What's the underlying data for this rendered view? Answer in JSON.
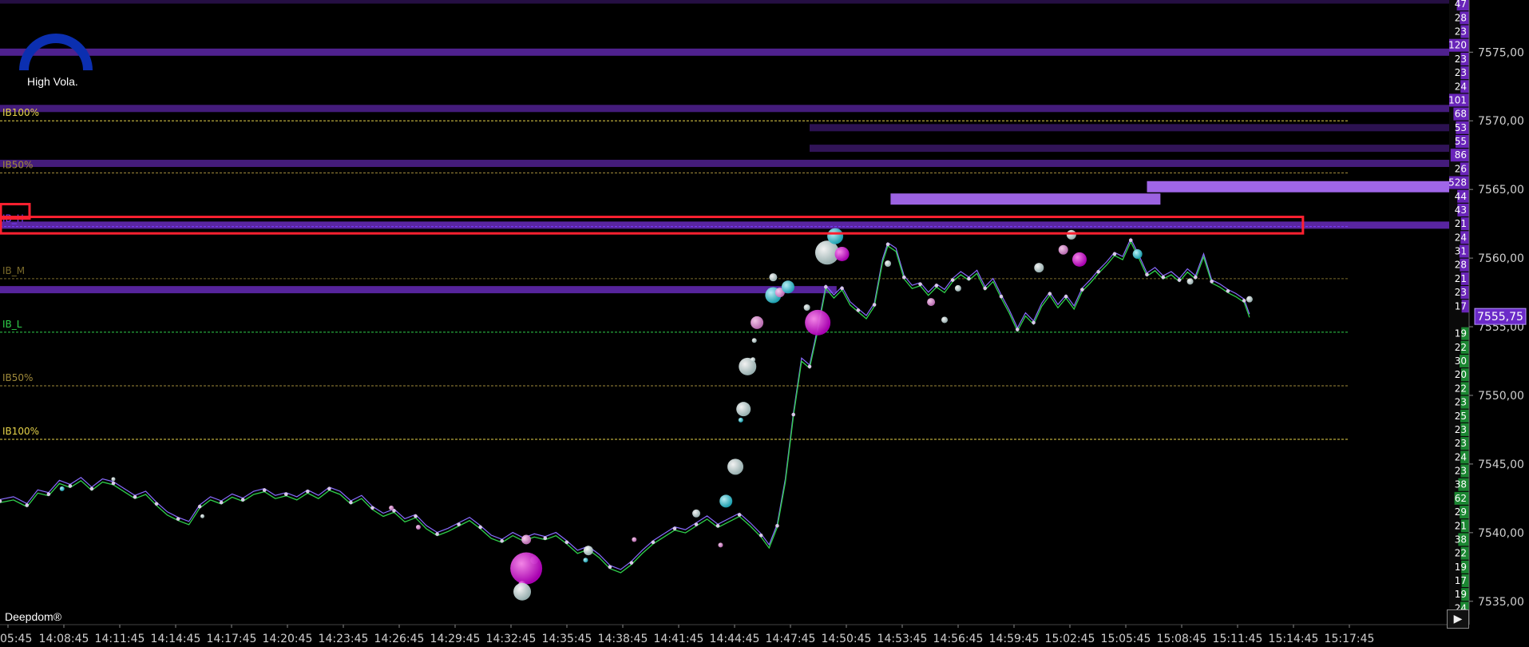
{
  "brand": "Deepdom®",
  "volatility": {
    "label": "High Vola.",
    "color": "#0b2fb0"
  },
  "play_button": "▶",
  "last_price_badge": "7555,75",
  "chart_data": {
    "type": "line",
    "x_ticks": [
      "05:45",
      "14:08:45",
      "14:11:45",
      "14:14:45",
      "14:17:45",
      "14:20:45",
      "14:23:45",
      "14:26:45",
      "14:29:45",
      "14:32:45",
      "14:35:45",
      "14:38:45",
      "14:41:45",
      "14:44:45",
      "14:47:45",
      "14:50:45",
      "14:53:45",
      "14:56:45",
      "14:59:45",
      "15:02:45",
      "15:05:45",
      "15:08:45",
      "15:11:45",
      "15:14:45",
      "15:17:45"
    ],
    "y_ticks": [
      "7575,00",
      "7570,00",
      "7565,00",
      "7560,00",
      "7555,00",
      "7550,00",
      "7545,00",
      "7540,00",
      "7535,00"
    ],
    "y_tick_values": [
      7575,
      7570,
      7565,
      7560,
      7555,
      7550,
      7545,
      7540,
      7535
    ],
    "ylim": [
      7533.3,
      7578.8
    ],
    "last_price": 7555.75,
    "ib_levels": [
      {
        "label": "IB100%",
        "price": 7570.0,
        "color": "#e6d34a",
        "bold": true
      },
      {
        "label": "IB50%",
        "price": 7566.2,
        "color": "#a08a3a",
        "bold": false
      },
      {
        "label": "IB_H",
        "price": 7562.3,
        "color": "#7a3cff",
        "bold": false
      },
      {
        "label": "IB_M",
        "price": 7558.5,
        "color": "#7a6a2a",
        "bold": false
      },
      {
        "label": "IB_L",
        "price": 7554.6,
        "color": "#2fd04a",
        "bold": false
      },
      {
        "label": "IB50%",
        "price": 7550.7,
        "color": "#a08a3a",
        "bold": false
      },
      {
        "label": "IB100%",
        "price": 7546.8,
        "color": "#e6d34a",
        "bold": true
      }
    ],
    "dom_ladder": [
      {
        "price": 7578.5,
        "size": "47"
      },
      {
        "price": 7577.5,
        "size": "28"
      },
      {
        "price": 7576.5,
        "size": "23"
      },
      {
        "price": 7575.5,
        "size": "120"
      },
      {
        "price": 7574.5,
        "size": "23"
      },
      {
        "price": 7573.5,
        "size": "23"
      },
      {
        "price": 7572.5,
        "size": "24"
      },
      {
        "price": 7571.5,
        "size": "101"
      },
      {
        "price": 7570.5,
        "size": "68"
      },
      {
        "price": 7569.5,
        "size": "53"
      },
      {
        "price": 7568.5,
        "size": "55"
      },
      {
        "price": 7567.5,
        "size": "86"
      },
      {
        "price": 7566.5,
        "size": "26"
      },
      {
        "price": 7565.5,
        "size": "528"
      },
      {
        "price": 7564.5,
        "size": "44"
      },
      {
        "price": 7563.5,
        "size": "43"
      },
      {
        "price": 7562.5,
        "size": "21"
      },
      {
        "price": 7561.5,
        "size": "24"
      },
      {
        "price": 7560.5,
        "size": "31"
      },
      {
        "price": 7559.5,
        "size": "28"
      },
      {
        "price": 7558.5,
        "size": "21"
      },
      {
        "price": 7557.5,
        "size": "23"
      },
      {
        "price": 7556.5,
        "size": "17"
      },
      {
        "price": 7554.5,
        "size": "19"
      },
      {
        "price": 7553.5,
        "size": "22"
      },
      {
        "price": 7552.5,
        "size": "30"
      },
      {
        "price": 7551.5,
        "size": "20"
      },
      {
        "price": 7550.5,
        "size": "22"
      },
      {
        "price": 7549.5,
        "size": "23"
      },
      {
        "price": 7548.5,
        "size": "25"
      },
      {
        "price": 7547.5,
        "size": "23"
      },
      {
        "price": 7546.5,
        "size": "23"
      },
      {
        "price": 7545.5,
        "size": "24"
      },
      {
        "price": 7544.5,
        "size": "23"
      },
      {
        "price": 7543.5,
        "size": "38"
      },
      {
        "price": 7542.5,
        "size": "62"
      },
      {
        "price": 7541.5,
        "size": "29"
      },
      {
        "price": 7540.5,
        "size": "21"
      },
      {
        "price": 7539.5,
        "size": "38"
      },
      {
        "price": 7538.5,
        "size": "22"
      },
      {
        "price": 7537.5,
        "size": "19"
      },
      {
        "price": 7536.5,
        "size": "17"
      },
      {
        "price": 7535.5,
        "size": "19"
      },
      {
        "price": 7534.5,
        "size": "24"
      }
    ],
    "heatmap_bands": [
      {
        "price": 7578.8,
        "from": 0,
        "to": 1.0,
        "intensity": 0.15
      },
      {
        "price": 7575.0,
        "from": 0,
        "to": 1.0,
        "intensity": 0.7
      },
      {
        "price": 7570.9,
        "from": 0,
        "to": 1.0,
        "intensity": 0.55
      },
      {
        "price": 7569.5,
        "from": 0.6,
        "to": 1.0,
        "intensity": 0.25
      },
      {
        "price": 7568.0,
        "from": 0.6,
        "to": 1.0,
        "intensity": 0.3
      },
      {
        "price": 7566.9,
        "from": 0,
        "to": 1.0,
        "intensity": 0.55
      },
      {
        "price": 7562.4,
        "from": 0,
        "to": 1.0,
        "intensity": 0.85
      },
      {
        "price": 7557.7,
        "from": 0,
        "to": 0.62,
        "intensity": 0.8
      },
      {
        "price": 7565.2,
        "from": 0.85,
        "to": 1.0,
        "intensity": 0.95
      },
      {
        "price": 7564.3,
        "from": 0.66,
        "to": 0.86,
        "intensity": 0.9
      }
    ],
    "line": [
      {
        "x": 0.0,
        "y": 7542.3
      },
      {
        "x": 0.01,
        "y": 7542.5
      },
      {
        "x": 0.02,
        "y": 7542.0
      },
      {
        "x": 0.028,
        "y": 7543.0
      },
      {
        "x": 0.036,
        "y": 7542.8
      },
      {
        "x": 0.044,
        "y": 7543.7
      },
      {
        "x": 0.052,
        "y": 7543.4
      },
      {
        "x": 0.06,
        "y": 7543.9
      },
      {
        "x": 0.068,
        "y": 7543.2
      },
      {
        "x": 0.076,
        "y": 7543.8
      },
      {
        "x": 0.084,
        "y": 7543.6
      },
      {
        "x": 0.092,
        "y": 7543.1
      },
      {
        "x": 0.1,
        "y": 7542.6
      },
      {
        "x": 0.108,
        "y": 7542.9
      },
      {
        "x": 0.116,
        "y": 7542.1
      },
      {
        "x": 0.124,
        "y": 7541.4
      },
      {
        "x": 0.132,
        "y": 7541.0
      },
      {
        "x": 0.14,
        "y": 7540.7
      },
      {
        "x": 0.148,
        "y": 7541.9
      },
      {
        "x": 0.156,
        "y": 7542.5
      },
      {
        "x": 0.164,
        "y": 7542.2
      },
      {
        "x": 0.172,
        "y": 7542.7
      },
      {
        "x": 0.18,
        "y": 7542.4
      },
      {
        "x": 0.188,
        "y": 7542.9
      },
      {
        "x": 0.196,
        "y": 7543.1
      },
      {
        "x": 0.204,
        "y": 7542.6
      },
      {
        "x": 0.212,
        "y": 7542.8
      },
      {
        "x": 0.22,
        "y": 7542.5
      },
      {
        "x": 0.228,
        "y": 7543.0
      },
      {
        "x": 0.236,
        "y": 7542.6
      },
      {
        "x": 0.244,
        "y": 7543.2
      },
      {
        "x": 0.252,
        "y": 7542.9
      },
      {
        "x": 0.26,
        "y": 7542.2
      },
      {
        "x": 0.268,
        "y": 7542.6
      },
      {
        "x": 0.276,
        "y": 7541.8
      },
      {
        "x": 0.284,
        "y": 7541.3
      },
      {
        "x": 0.292,
        "y": 7541.6
      },
      {
        "x": 0.3,
        "y": 7540.9
      },
      {
        "x": 0.308,
        "y": 7541.2
      },
      {
        "x": 0.316,
        "y": 7540.4
      },
      {
        "x": 0.324,
        "y": 7539.9
      },
      {
        "x": 0.332,
        "y": 7540.2
      },
      {
        "x": 0.34,
        "y": 7540.6
      },
      {
        "x": 0.348,
        "y": 7541.0
      },
      {
        "x": 0.356,
        "y": 7540.4
      },
      {
        "x": 0.364,
        "y": 7539.7
      },
      {
        "x": 0.372,
        "y": 7539.4
      },
      {
        "x": 0.38,
        "y": 7539.9
      },
      {
        "x": 0.388,
        "y": 7539.5
      },
      {
        "x": 0.396,
        "y": 7539.8
      },
      {
        "x": 0.404,
        "y": 7539.6
      },
      {
        "x": 0.412,
        "y": 7539.9
      },
      {
        "x": 0.42,
        "y": 7539.3
      },
      {
        "x": 0.428,
        "y": 7538.6
      },
      {
        "x": 0.436,
        "y": 7538.9
      },
      {
        "x": 0.444,
        "y": 7538.3
      },
      {
        "x": 0.452,
        "y": 7537.5
      },
      {
        "x": 0.46,
        "y": 7537.2
      },
      {
        "x": 0.468,
        "y": 7537.8
      },
      {
        "x": 0.476,
        "y": 7538.6
      },
      {
        "x": 0.484,
        "y": 7539.3
      },
      {
        "x": 0.492,
        "y": 7539.8
      },
      {
        "x": 0.5,
        "y": 7540.3
      },
      {
        "x": 0.508,
        "y": 7540.1
      },
      {
        "x": 0.516,
        "y": 7540.6
      },
      {
        "x": 0.524,
        "y": 7541.1
      },
      {
        "x": 0.532,
        "y": 7540.5
      },
      {
        "x": 0.54,
        "y": 7540.9
      },
      {
        "x": 0.548,
        "y": 7541.3
      },
      {
        "x": 0.556,
        "y": 7540.6
      },
      {
        "x": 0.564,
        "y": 7539.8
      },
      {
        "x": 0.57,
        "y": 7539.0
      },
      {
        "x": 0.576,
        "y": 7540.5
      },
      {
        "x": 0.582,
        "y": 7543.8
      },
      {
        "x": 0.588,
        "y": 7548.6
      },
      {
        "x": 0.594,
        "y": 7552.6
      },
      {
        "x": 0.6,
        "y": 7552.1
      },
      {
        "x": 0.606,
        "y": 7554.8
      },
      {
        "x": 0.612,
        "y": 7557.9
      },
      {
        "x": 0.618,
        "y": 7557.2
      },
      {
        "x": 0.624,
        "y": 7557.8
      },
      {
        "x": 0.63,
        "y": 7556.7
      },
      {
        "x": 0.636,
        "y": 7556.2
      },
      {
        "x": 0.642,
        "y": 7555.7
      },
      {
        "x": 0.648,
        "y": 7556.6
      },
      {
        "x": 0.654,
        "y": 7559.8
      },
      {
        "x": 0.658,
        "y": 7561.0
      },
      {
        "x": 0.664,
        "y": 7560.6
      },
      {
        "x": 0.67,
        "y": 7558.6
      },
      {
        "x": 0.676,
        "y": 7557.9
      },
      {
        "x": 0.682,
        "y": 7558.1
      },
      {
        "x": 0.688,
        "y": 7557.4
      },
      {
        "x": 0.694,
        "y": 7558.0
      },
      {
        "x": 0.7,
        "y": 7557.6
      },
      {
        "x": 0.706,
        "y": 7558.4
      },
      {
        "x": 0.712,
        "y": 7558.9
      },
      {
        "x": 0.718,
        "y": 7558.5
      },
      {
        "x": 0.724,
        "y": 7559.0
      },
      {
        "x": 0.73,
        "y": 7557.8
      },
      {
        "x": 0.736,
        "y": 7558.4
      },
      {
        "x": 0.742,
        "y": 7557.2
      },
      {
        "x": 0.748,
        "y": 7556.1
      },
      {
        "x": 0.754,
        "y": 7554.8
      },
      {
        "x": 0.76,
        "y": 7555.9
      },
      {
        "x": 0.766,
        "y": 7555.3
      },
      {
        "x": 0.772,
        "y": 7556.6
      },
      {
        "x": 0.778,
        "y": 7557.4
      },
      {
        "x": 0.784,
        "y": 7556.5
      },
      {
        "x": 0.79,
        "y": 7557.2
      },
      {
        "x": 0.796,
        "y": 7556.4
      },
      {
        "x": 0.802,
        "y": 7557.7
      },
      {
        "x": 0.808,
        "y": 7558.3
      },
      {
        "x": 0.814,
        "y": 7559.0
      },
      {
        "x": 0.82,
        "y": 7559.6
      },
      {
        "x": 0.826,
        "y": 7560.3
      },
      {
        "x": 0.832,
        "y": 7560.0
      },
      {
        "x": 0.838,
        "y": 7561.3
      },
      {
        "x": 0.844,
        "y": 7560.1
      },
      {
        "x": 0.85,
        "y": 7558.8
      },
      {
        "x": 0.856,
        "y": 7559.2
      },
      {
        "x": 0.862,
        "y": 7558.6
      },
      {
        "x": 0.868,
        "y": 7558.9
      },
      {
        "x": 0.874,
        "y": 7558.4
      },
      {
        "x": 0.88,
        "y": 7559.1
      },
      {
        "x": 0.886,
        "y": 7558.6
      },
      {
        "x": 0.892,
        "y": 7560.2
      },
      {
        "x": 0.898,
        "y": 7558.3
      },
      {
        "x": 0.904,
        "y": 7558.0
      },
      {
        "x": 0.91,
        "y": 7557.6
      },
      {
        "x": 0.916,
        "y": 7557.3
      },
      {
        "x": 0.922,
        "y": 7556.9
      },
      {
        "x": 0.926,
        "y": 7555.8
      }
    ],
    "bubbles": [
      {
        "x": 0.046,
        "y": 7543.2,
        "r": 3,
        "kind": "cyan"
      },
      {
        "x": 0.084,
        "y": 7543.9,
        "r": 2.5,
        "kind": "white"
      },
      {
        "x": 0.15,
        "y": 7541.2,
        "r": 2.5,
        "kind": "white"
      },
      {
        "x": 0.29,
        "y": 7541.8,
        "r": 3,
        "kind": "pink"
      },
      {
        "x": 0.31,
        "y": 7540.4,
        "r": 3,
        "kind": "pink"
      },
      {
        "x": 0.39,
        "y": 7539.5,
        "r": 6,
        "kind": "pink"
      },
      {
        "x": 0.396,
        "y": 7538.0,
        "r": 5,
        "kind": "white"
      },
      {
        "x": 0.39,
        "y": 7537.4,
        "r": 20,
        "kind": "magenta"
      },
      {
        "x": 0.387,
        "y": 7536.2,
        "r": 5,
        "kind": "magenta"
      },
      {
        "x": 0.387,
        "y": 7535.7,
        "r": 11,
        "kind": "white"
      },
      {
        "x": 0.436,
        "y": 7538.7,
        "r": 6,
        "kind": "white"
      },
      {
        "x": 0.434,
        "y": 7538.0,
        "r": 3,
        "kind": "cyan"
      },
      {
        "x": 0.47,
        "y": 7539.5,
        "r": 3,
        "kind": "pink"
      },
      {
        "x": 0.516,
        "y": 7541.4,
        "r": 5,
        "kind": "white"
      },
      {
        "x": 0.534,
        "y": 7539.1,
        "r": 3,
        "kind": "pink"
      },
      {
        "x": 0.538,
        "y": 7542.3,
        "r": 8,
        "kind": "cyan"
      },
      {
        "x": 0.545,
        "y": 7544.8,
        "r": 10,
        "kind": "white"
      },
      {
        "x": 0.549,
        "y": 7548.2,
        "r": 3,
        "kind": "cyan"
      },
      {
        "x": 0.551,
        "y": 7549.0,
        "r": 9,
        "kind": "white"
      },
      {
        "x": 0.554,
        "y": 7552.1,
        "r": 11,
        "kind": "white"
      },
      {
        "x": 0.558,
        "y": 7552.6,
        "r": 3,
        "kind": "white"
      },
      {
        "x": 0.559,
        "y": 7554.0,
        "r": 3,
        "kind": "white"
      },
      {
        "x": 0.561,
        "y": 7555.3,
        "r": 8,
        "kind": "pink"
      },
      {
        "x": 0.573,
        "y": 7557.3,
        "r": 10,
        "kind": "cyan"
      },
      {
        "x": 0.578,
        "y": 7557.5,
        "r": 6,
        "kind": "pink"
      },
      {
        "x": 0.584,
        "y": 7557.9,
        "r": 8,
        "kind": "cyan"
      },
      {
        "x": 0.573,
        "y": 7558.6,
        "r": 5,
        "kind": "white"
      },
      {
        "x": 0.606,
        "y": 7555.3,
        "r": 16,
        "kind": "magenta"
      },
      {
        "x": 0.613,
        "y": 7560.4,
        "r": 15,
        "kind": "white"
      },
      {
        "x": 0.619,
        "y": 7561.6,
        "r": 10,
        "kind": "cyan"
      },
      {
        "x": 0.624,
        "y": 7560.3,
        "r": 9,
        "kind": "magenta"
      },
      {
        "x": 0.598,
        "y": 7556.4,
        "r": 4,
        "kind": "white"
      },
      {
        "x": 0.658,
        "y": 7559.6,
        "r": 4,
        "kind": "white"
      },
      {
        "x": 0.69,
        "y": 7556.8,
        "r": 5,
        "kind": "pink"
      },
      {
        "x": 0.7,
        "y": 7555.5,
        "r": 4,
        "kind": "white"
      },
      {
        "x": 0.71,
        "y": 7557.8,
        "r": 4,
        "kind": "white"
      },
      {
        "x": 0.77,
        "y": 7559.3,
        "r": 6,
        "kind": "white"
      },
      {
        "x": 0.788,
        "y": 7560.6,
        "r": 6,
        "kind": "pink"
      },
      {
        "x": 0.794,
        "y": 7561.7,
        "r": 6,
        "kind": "white"
      },
      {
        "x": 0.8,
        "y": 7559.9,
        "r": 9,
        "kind": "magenta"
      },
      {
        "x": 0.843,
        "y": 7560.3,
        "r": 6,
        "kind": "cyan"
      },
      {
        "x": 0.882,
        "y": 7558.3,
        "r": 4,
        "kind": "white"
      },
      {
        "x": 0.926,
        "y": 7557.0,
        "r": 4,
        "kind": "white"
      }
    ],
    "highlight_box": {
      "price_top": 7563.0,
      "price_bottom": 7561.8,
      "x_from": 0.0,
      "x_to": 0.965
    }
  }
}
